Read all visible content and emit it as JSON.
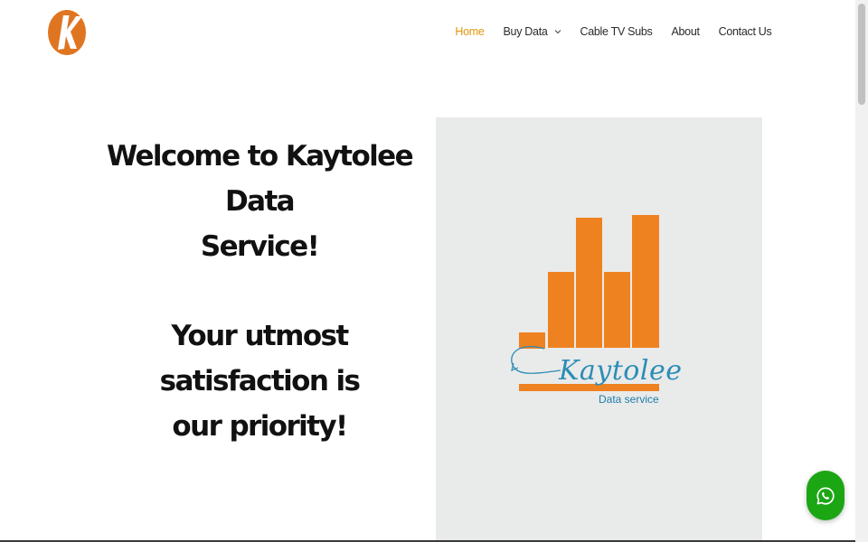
{
  "header": {
    "logo_icon": "kaytolee-k-logo",
    "nav": [
      {
        "label": "Home",
        "active": true
      },
      {
        "label": "Buy Data",
        "has_dropdown": true
      },
      {
        "label": "Cable TV Subs"
      },
      {
        "label": "About"
      },
      {
        "label": "Contact Us"
      }
    ]
  },
  "hero": {
    "welcome_line1": "Welcome to Kaytolee Data",
    "welcome_line2": "Service!",
    "tagline_line1": "Your utmost satisfaction is",
    "tagline_line2": "our priority!"
  },
  "brand_image": {
    "script_text": "Kaytolee",
    "sub_text": "Data service"
  },
  "floating": {
    "whatsapp_icon": "whatsapp-icon"
  },
  "colors": {
    "accent": "#e2960c",
    "bar_orange": "#ef8220",
    "logo_orange": "#e07521",
    "brand_blue": "#2b8db5",
    "whatsapp_green": "#1ca614",
    "panel_bg": "#e9eaea"
  }
}
